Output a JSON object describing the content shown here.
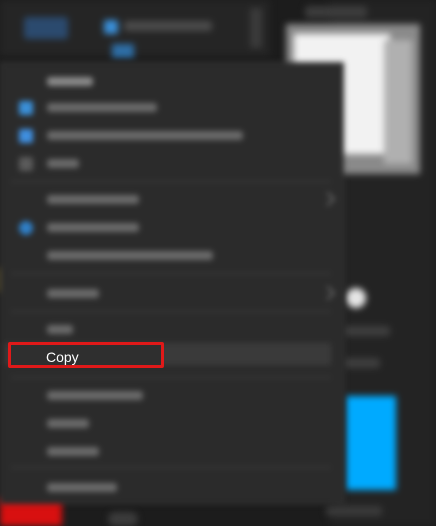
{
  "context_menu": {
    "highlighted_item": {
      "label": "Copy"
    }
  },
  "colors": {
    "highlight_border": "#e01919",
    "menu_background": "#2b2b2b",
    "accent_blue": "#00aaff"
  },
  "icons": [
    "open-icon",
    "share-icon",
    "gear-icon",
    "info-icon",
    "chevron-right-icon"
  ]
}
